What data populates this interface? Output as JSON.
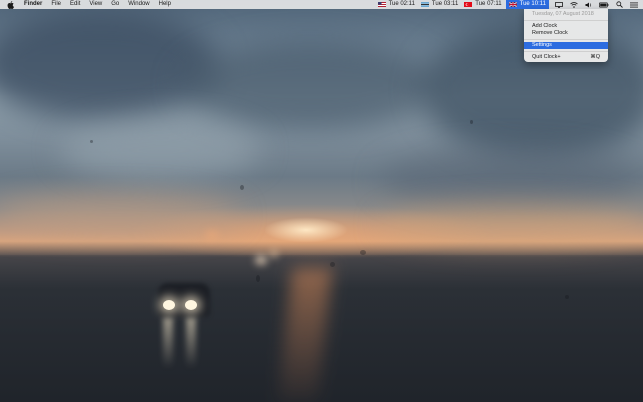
{
  "menubar": {
    "app_name": "Finder",
    "menus": [
      "File",
      "Edit",
      "View",
      "Go",
      "Window",
      "Help"
    ],
    "clocks": [
      {
        "flag": "us-flag-icon",
        "time": "Tue 02:11"
      },
      {
        "flag": "bw-flag-icon",
        "time": "Tue 03:11"
      },
      {
        "flag": "tr-flag-icon",
        "time": "Tue 07:11"
      },
      {
        "flag": "uk-flag-icon",
        "time": "Tue 10:11"
      }
    ],
    "status_icons": [
      "display-icon",
      "wifi-icon",
      "volume-icon",
      "battery-icon",
      "search-icon",
      "notification-center-icon"
    ]
  },
  "dropdown": {
    "date": "Tuesday, 07 August 2018",
    "add_clock": "Add Clock",
    "remove_clock": "Remove Clock",
    "settings": "Settings",
    "quit": "Quit Clock+",
    "quit_shortcut": "⌘Q"
  },
  "colors": {
    "highlight": "#2c6ce0",
    "menubar": "#ececec"
  }
}
